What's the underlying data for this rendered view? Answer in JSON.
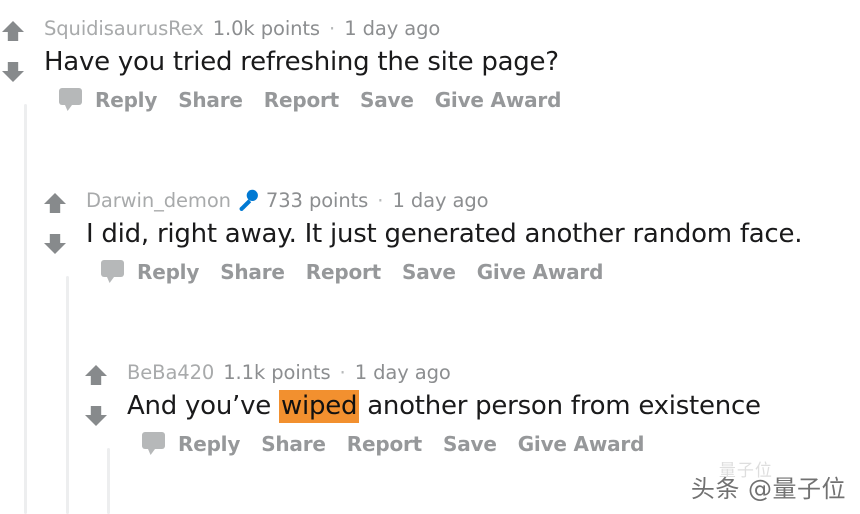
{
  "colors": {
    "background": "#ffffff",
    "body_text": "#1a1a1b",
    "meta_text": "#8c8e90",
    "username_text": "#a8aaab",
    "action_text": "#96989a",
    "thread_line": "#edeeef",
    "vote_arrow": "#878a8c",
    "op_badge": "#0079d3",
    "highlight": "#f2902f"
  },
  "thread": {
    "lines": [
      {
        "name": "thread-line-depth-0"
      },
      {
        "name": "thread-line-depth-1"
      },
      {
        "name": "thread-line-depth-2"
      }
    ]
  },
  "comments": [
    {
      "username": "SquidisaurusRex",
      "op_badge": false,
      "points": "1.0k points",
      "separator": "·",
      "timestamp": "1 day ago",
      "body_before": "Have you tried refreshing the site page?",
      "body_highlight": "",
      "body_after": "",
      "upvote_icon": "upvote-arrow-icon",
      "downvote_icon": "downvote-arrow-icon",
      "bubble_icon": "comment-bubble-icon",
      "actions": [
        "Reply",
        "Share",
        "Report",
        "Save",
        "Give Award"
      ]
    },
    {
      "username": "Darwin_demon",
      "op_badge": true,
      "op_badge_icon": "microphone-icon",
      "points": "733 points",
      "separator": "·",
      "timestamp": "1 day ago",
      "body_before": "I did, right away. It just generated another random face.",
      "body_highlight": "",
      "body_after": "",
      "upvote_icon": "upvote-arrow-icon",
      "downvote_icon": "downvote-arrow-icon",
      "bubble_icon": "comment-bubble-icon",
      "actions": [
        "Reply",
        "Share",
        "Report",
        "Save",
        "Give Award"
      ]
    },
    {
      "username": "BeBa420",
      "op_badge": false,
      "points": "1.1k points",
      "separator": "·",
      "timestamp": "1 day ago",
      "body_before": "And you’ve ",
      "body_highlight": "wiped",
      "body_after": " another person from existence",
      "upvote_icon": "upvote-arrow-icon",
      "downvote_icon": "downvote-arrow-icon",
      "bubble_icon": "comment-bubble-icon",
      "actions": [
        "Reply",
        "Share",
        "Report",
        "Save",
        "Give Award"
      ]
    }
  ],
  "watermark": {
    "text": "头条 @量子位",
    "ghost_text": "量子位"
  }
}
